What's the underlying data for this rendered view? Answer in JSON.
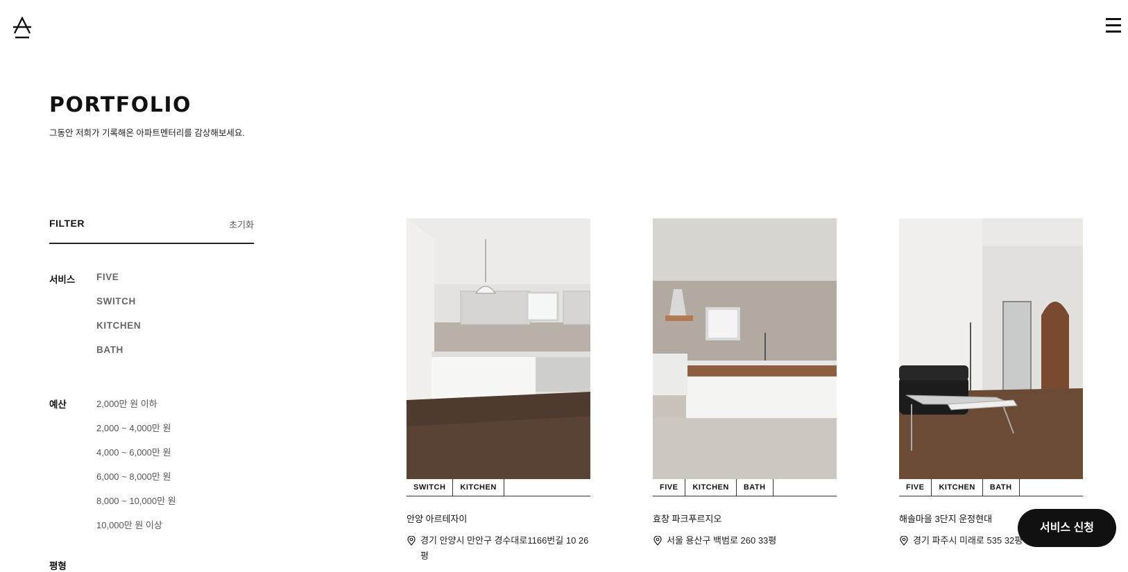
{
  "page": {
    "title": "PORTFOLIO",
    "subtitle": "그동안 저희가 기록해온 아파트멘터리를 감상해보세요."
  },
  "filter": {
    "title": "FILTER",
    "reset_label": "초기화",
    "service": {
      "label": "서비스",
      "options": [
        "FIVE",
        "SWITCH",
        "KITCHEN",
        "BATH"
      ]
    },
    "budget": {
      "label": "예산",
      "options": [
        "2,000만 원 이하",
        "2,000 ~ 4,000만 원",
        "4,000 ~ 6,000만 원",
        "6,000 ~ 8,000만 원",
        "8,000 ~ 10,000만 원",
        "10,000만 원 이상"
      ]
    },
    "area": {
      "label": "평형"
    }
  },
  "cards": [
    {
      "tags": [
        "SWITCH",
        "KITCHEN"
      ],
      "title": "안양 아르테자이",
      "address": "경기 안양시 만안구 경수대로1166번길 10 26평"
    },
    {
      "tags": [
        "FIVE",
        "KITCHEN",
        "BATH"
      ],
      "title": "효창 파크푸르지오",
      "address": "서울 용산구 백범로 260 33평"
    },
    {
      "tags": [
        "FIVE",
        "KITCHEN",
        "BATH"
      ],
      "title": "해솔마을 3단지 운정현대",
      "address": "경기 파주시 미래로 535 32평"
    }
  ],
  "cta": {
    "label": "서비스 신청"
  },
  "icons": {
    "logo": "brand-a-logo",
    "menu": "hamburger-icon",
    "pin": "location-pin-icon"
  },
  "colors": {
    "text": "#111111",
    "cta_bg": "#111111",
    "cta_text": "#ffffff",
    "muted": "#555555"
  }
}
